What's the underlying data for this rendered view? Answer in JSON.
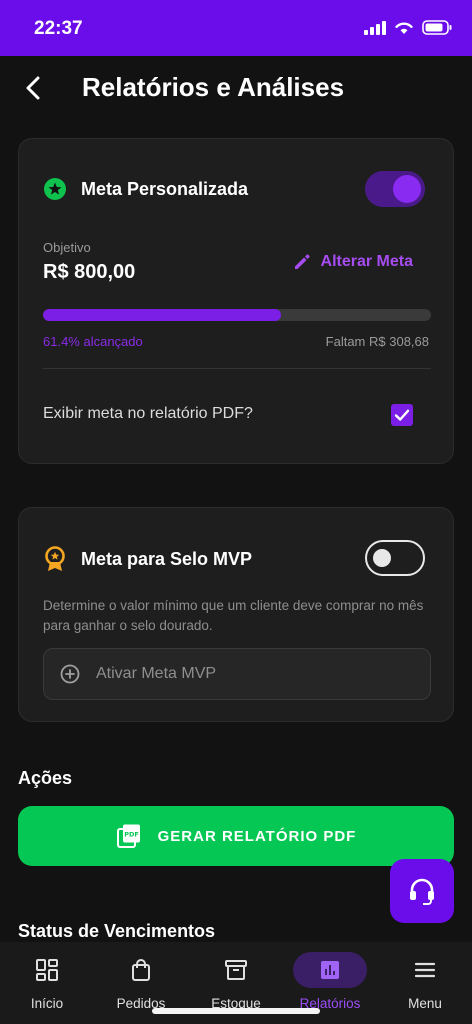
{
  "status_bar": {
    "time": "22:37"
  },
  "header": {
    "title": "Relatórios e Análises"
  },
  "custom_goal": {
    "title": "Meta Personalizada",
    "enabled": true,
    "objective_label": "Objetivo",
    "objective_value": "R$ 800,00",
    "edit_label": "Alterar Meta",
    "progress_fraction": 0.614,
    "progress_text": "61.4% alcançado",
    "remaining_text": "Faltam R$ 308,68",
    "pdf_option_label": "Exibir meta no relatório PDF?",
    "pdf_option_checked": true
  },
  "mvp_goal": {
    "title": "Meta para Selo MVP",
    "enabled": false,
    "description": "Determine o valor mínimo que um cliente deve comprar no mês para ganhar o selo dourado.",
    "activate_label": "Ativar Meta MVP"
  },
  "actions": {
    "title": "Ações",
    "pdf_button_label": "GERAR RELATÓRIO PDF"
  },
  "due_status": {
    "title": "Status de Vencimentos"
  },
  "nav": {
    "items": [
      {
        "label": "Início",
        "icon": "dashboard-icon"
      },
      {
        "label": "Pedidos",
        "icon": "shopping-bag-icon"
      },
      {
        "label": "Estoque",
        "icon": "archive-box-icon"
      },
      {
        "label": "Relatórios",
        "icon": "bar-chart-icon",
        "active": true
      },
      {
        "label": "Menu",
        "icon": "hamburger-menu-icon"
      }
    ]
  },
  "colors": {
    "brand_purple": "#6a0dea",
    "accent_purple": "#8b2be8",
    "success_green": "#05c854",
    "badge_orange": "#f5a623"
  }
}
